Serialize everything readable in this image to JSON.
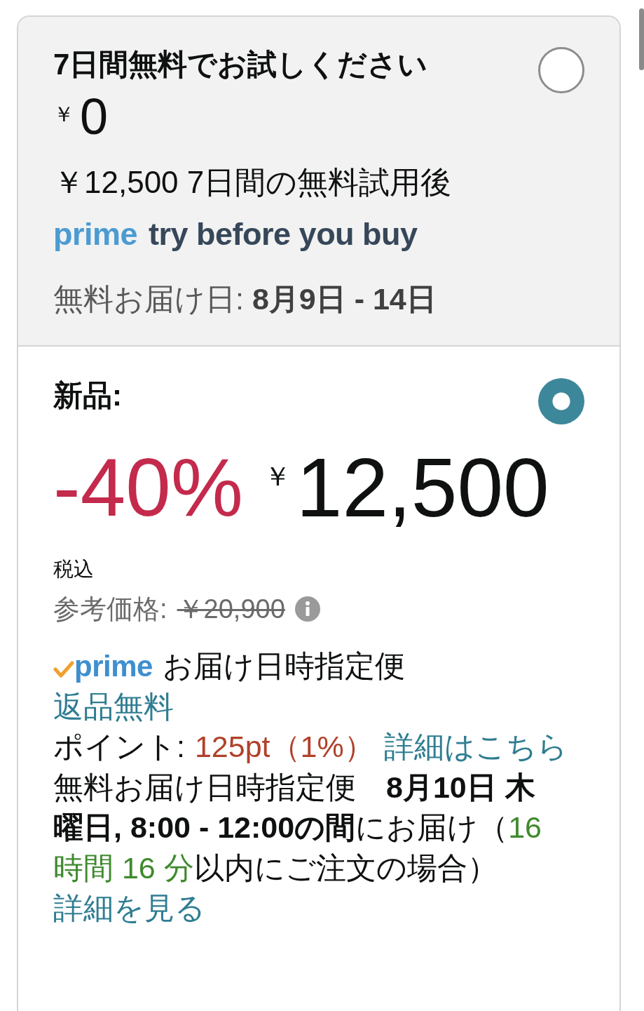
{
  "offers": [
    {
      "kind": "trial",
      "selected": false,
      "title": "7日間無料でお試しください",
      "currency": "￥",
      "price": "0",
      "after_trial": "￥12,500 7日間の無料試用後",
      "program": {
        "logo": "prime",
        "tagline": "try before you buy"
      },
      "delivery": "無料お届け日: **8月9日 - 14日**"
    },
    {
      "kind": "purchase",
      "selected": true,
      "title": "新品:",
      "discount": "-40%",
      "currency": "￥",
      "price": "12,500",
      "tax_note": "税込",
      "reference_price": {
        "label": "参考価格:",
        "value": "￥20,900"
      },
      "delivery_badge": {
        "logo": "prime",
        "service": "お届け日時指定便"
      },
      "returns": "返品無料",
      "points": {
        "label": "ポイント:",
        "value": "125pt（1%）",
        "link": "詳細はこちら"
      },
      "delivery_detail": [
        {
          "kind": "plain",
          "text": "無料お届け日時指定便　"
        },
        {
          "kind": "bold",
          "text": "8月10日 木曜日, 8:00 - 12:00の間"
        },
        {
          "kind": "plain",
          "text": "にお届け（"
        },
        {
          "kind": "countdown",
          "text": "16 時間 16 分"
        },
        {
          "kind": "plain",
          "text": "以内にご注文の場合）"
        }
      ],
      "details_link": "詳細を見る"
    }
  ]
}
